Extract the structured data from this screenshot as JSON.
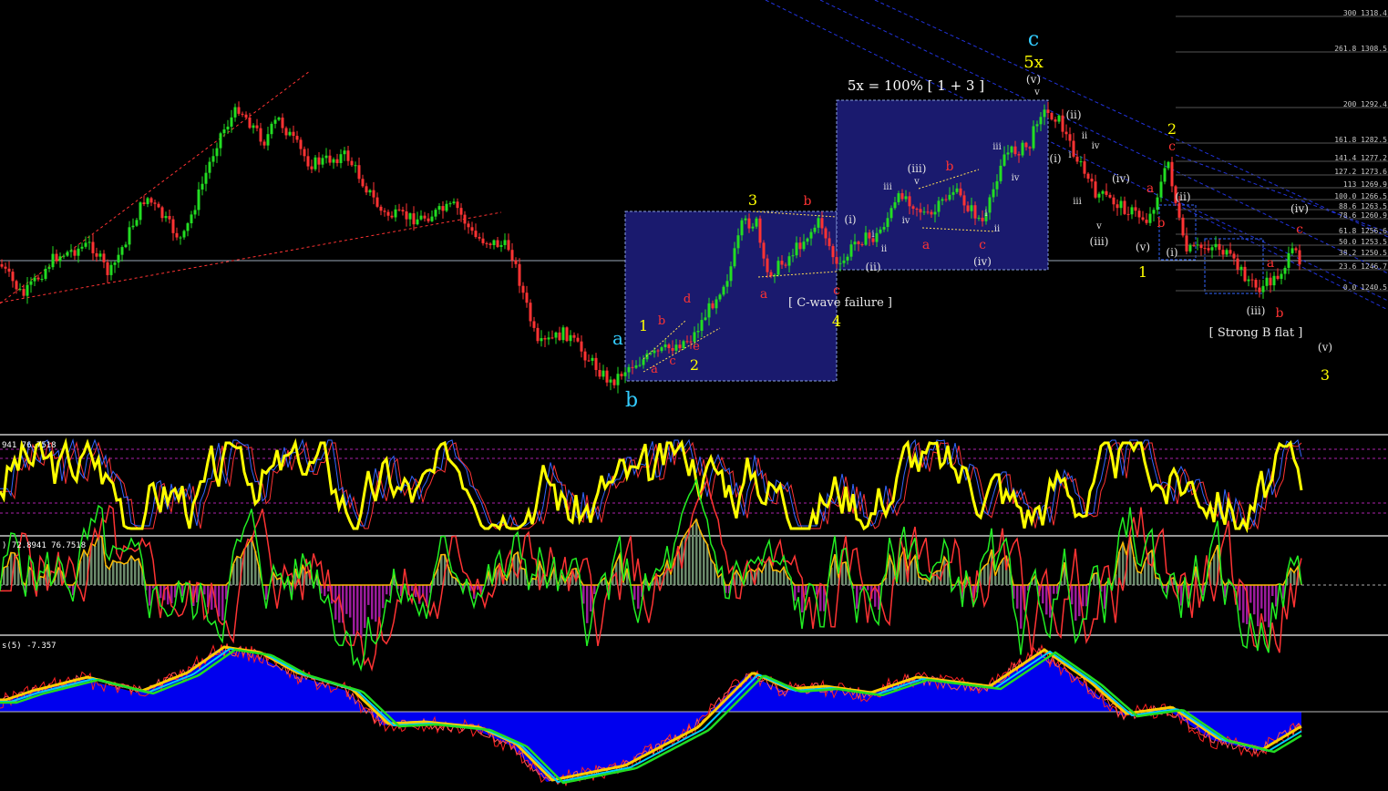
{
  "colors": {
    "background": "#000000",
    "bull": "#22dd22",
    "bear": "#ff3333",
    "box": "#1a1a6e",
    "boxBorder": "#8aa0e0",
    "yellow": "#ffff00",
    "cyan": "#33ccff",
    "orangeLabel": "#ffcc33",
    "red": "#ff3333",
    "white": "#e0e0e0",
    "histUp": "#6b8a6b",
    "histDown": "#9b1b9b",
    "blueFill": "#0000ee"
  },
  "main": {
    "annotations": {
      "ratio": "5x = 100% [ 1 + 3 ]",
      "cfail": "[ C-wave failure ]",
      "strongb": "[ Strong B flat ]"
    },
    "wave_labels": [
      {
        "t": "c",
        "c": "cyan"
      },
      {
        "t": "5x",
        "c": "yellow"
      },
      {
        "t": "(v)",
        "c": "white"
      },
      {
        "t": "v",
        "c": "white"
      },
      {
        "t": "a",
        "c": "cyan"
      },
      {
        "t": "b",
        "c": "cyan"
      },
      {
        "t": "1",
        "c": "yellow"
      },
      {
        "t": "2",
        "c": "yellow"
      },
      {
        "t": "3",
        "c": "yellow"
      },
      {
        "t": "4",
        "c": "yellow"
      },
      {
        "t": "1",
        "c": "yellow"
      },
      {
        "t": "2",
        "c": "yellow"
      },
      {
        "t": "3",
        "c": "yellow"
      },
      {
        "t": "a",
        "c": "red"
      },
      {
        "t": "b",
        "c": "red"
      },
      {
        "t": "c",
        "c": "red"
      },
      {
        "t": "d",
        "c": "red"
      },
      {
        "t": "e",
        "c": "red"
      },
      {
        "t": "a",
        "c": "red"
      },
      {
        "t": "b",
        "c": "red"
      },
      {
        "t": "c",
        "c": "red"
      },
      {
        "t": "a",
        "c": "red"
      },
      {
        "t": "b",
        "c": "red"
      },
      {
        "t": "c",
        "c": "red"
      },
      {
        "t": "a",
        "c": "red"
      },
      {
        "t": "b",
        "c": "red"
      },
      {
        "t": "c",
        "c": "red"
      },
      {
        "t": "a",
        "c": "red"
      },
      {
        "t": "b",
        "c": "red"
      },
      {
        "t": "c",
        "c": "red"
      },
      {
        "t": "(i)",
        "c": "white"
      },
      {
        "t": "(ii)",
        "c": "white"
      },
      {
        "t": "(iii)",
        "c": "white"
      },
      {
        "t": "(iv)",
        "c": "white"
      },
      {
        "t": "i",
        "c": "white"
      },
      {
        "t": "ii",
        "c": "white"
      },
      {
        "t": "iii",
        "c": "white"
      },
      {
        "t": "iv",
        "c": "white"
      },
      {
        "t": "v",
        "c": "white"
      },
      {
        "t": "iii",
        "c": "white"
      },
      {
        "t": "iv",
        "c": "white"
      },
      {
        "t": "i",
        "c": "white"
      },
      {
        "t": "ii",
        "c": "white"
      },
      {
        "t": "(i)",
        "c": "white"
      },
      {
        "t": "(ii)",
        "c": "white"
      },
      {
        "t": "i",
        "c": "white"
      },
      {
        "t": "ii",
        "c": "white"
      },
      {
        "t": "iii",
        "c": "white"
      },
      {
        "t": "iv",
        "c": "white"
      },
      {
        "t": "v",
        "c": "white"
      },
      {
        "t": "(iii)",
        "c": "white"
      },
      {
        "t": "(iv)",
        "c": "white"
      },
      {
        "t": "(v)",
        "c": "white"
      },
      {
        "t": "(i)",
        "c": "white"
      },
      {
        "t": "(ii)",
        "c": "white"
      },
      {
        "t": "(iii)",
        "c": "white"
      },
      {
        "t": "(iv)",
        "c": "white"
      },
      {
        "t": "(v)",
        "c": "white"
      }
    ]
  },
  "chart_data": [
    {
      "type": "candlestick",
      "fib_levels": [
        {
          "label": "300 1318.4"
        },
        {
          "label": "261.8 1308.5"
        },
        {
          "label": "200 1292.4"
        },
        {
          "label": "161.8 1282.5"
        },
        {
          "label": "141.4 1277.2"
        },
        {
          "label": "127.2 1273.6"
        },
        {
          "label": "113 1269.9"
        },
        {
          "label": "100.0 1266.5"
        },
        {
          "label": "88.6 1263.5"
        },
        {
          "label": "78.6 1260.9"
        },
        {
          "label": "61.8 1256.6"
        },
        {
          "label": "50.0 1253.5"
        },
        {
          "label": "38.2 1250.5"
        },
        {
          "label": "23.6 1246.7"
        },
        {
          "label": "0.0 1240.5"
        }
      ]
    },
    {
      "type": "line",
      "label": "941 76.7518"
    },
    {
      "type": "bar",
      "label": ") 72.8941 76.7518"
    },
    {
      "type": "area",
      "label": "s(5) -7.357"
    }
  ]
}
